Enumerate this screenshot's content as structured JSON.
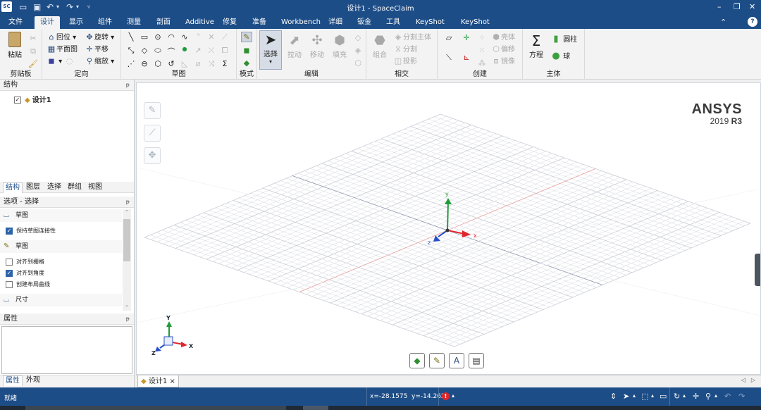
{
  "app": {
    "title": "设计1 - SpaceClaim",
    "logo": "SC"
  },
  "quick_access": [
    "open-folder-icon",
    "save-icon",
    "undo-icon",
    "redo-icon",
    "customize-icon"
  ],
  "tabs": [
    {
      "label": "文件",
      "active": false
    },
    {
      "label": "设计",
      "active": true
    },
    {
      "label": "显示",
      "active": false
    },
    {
      "label": "组件",
      "active": false
    },
    {
      "label": "测量",
      "active": false
    },
    {
      "label": "剖面",
      "active": false
    },
    {
      "label": "Additive",
      "active": false
    },
    {
      "label": "修复",
      "active": false
    },
    {
      "label": "准备",
      "active": false
    },
    {
      "label": "Workbench",
      "active": false
    },
    {
      "label": "详细",
      "active": false
    },
    {
      "label": "钣金",
      "active": false
    },
    {
      "label": "工具",
      "active": false
    },
    {
      "label": "KeyShot",
      "active": false
    },
    {
      "label": "KeyShot",
      "active": false
    }
  ],
  "ribbon": {
    "clipboard": {
      "label": "剪贴板",
      "paste": "粘贴"
    },
    "orient": {
      "label": "定向",
      "home": "回位",
      "plan_view": "平面图",
      "rotate": "旋转",
      "pan": "平移",
      "zoom": "缩放"
    },
    "sketch": {
      "label": "草图"
    },
    "mode": {
      "label": "模式"
    },
    "edit": {
      "label": "编辑",
      "select": "选择",
      "pull": "拉动",
      "move": "移动",
      "fill": "填充"
    },
    "intersect": {
      "label": "相交",
      "combine": "组合",
      "split_body": "分割主体",
      "split": "分割",
      "project": "投影"
    },
    "create": {
      "label": "创建",
      "shell": "壳体",
      "offset": "偏移",
      "mirror": "镜像"
    },
    "body": {
      "label": "主体",
      "equation": "方程",
      "cylinder": "圆柱",
      "sphere": "球"
    }
  },
  "structure_panel": {
    "title": "结构",
    "tree_item": "设计1"
  },
  "panel_tabs": [
    "结构",
    "图层",
    "选择",
    "群组",
    "视图"
  ],
  "options_panel": {
    "title": "选项 - 选择",
    "section1": "草图",
    "keep_connectivity": {
      "label": "保持草图连接性",
      "checked": true
    },
    "section2": "草图",
    "snap_grid": {
      "label": "对齐到栅格",
      "checked": false
    },
    "snap_angle": {
      "label": "对齐到角度",
      "checked": true
    },
    "create_layout": {
      "label": "创建布局曲线",
      "checked": false
    },
    "section3": "尺寸"
  },
  "properties_panel": {
    "title": "属性"
  },
  "left_bottom_tabs": [
    "属性",
    "外观"
  ],
  "viewport": {
    "brand": "ANSYS",
    "version_year": "2019",
    "version_rel": "R3",
    "axis_x": "x",
    "axis_y": "y",
    "axis_z": "z",
    "triad_x": "X",
    "triad_y": "Y",
    "triad_z": "Z"
  },
  "doc_tab": {
    "label": "设计1",
    "close": "×"
  },
  "status": {
    "text": "就绪",
    "coords": "x=-28.1575  y=-14.2626"
  },
  "colors": {
    "chrome_blue": "#1d4d87",
    "axis_x": "#e0262b",
    "axis_y": "#1f9c3a",
    "axis_z": "#2950c8",
    "grid": "#c9cbd6"
  }
}
